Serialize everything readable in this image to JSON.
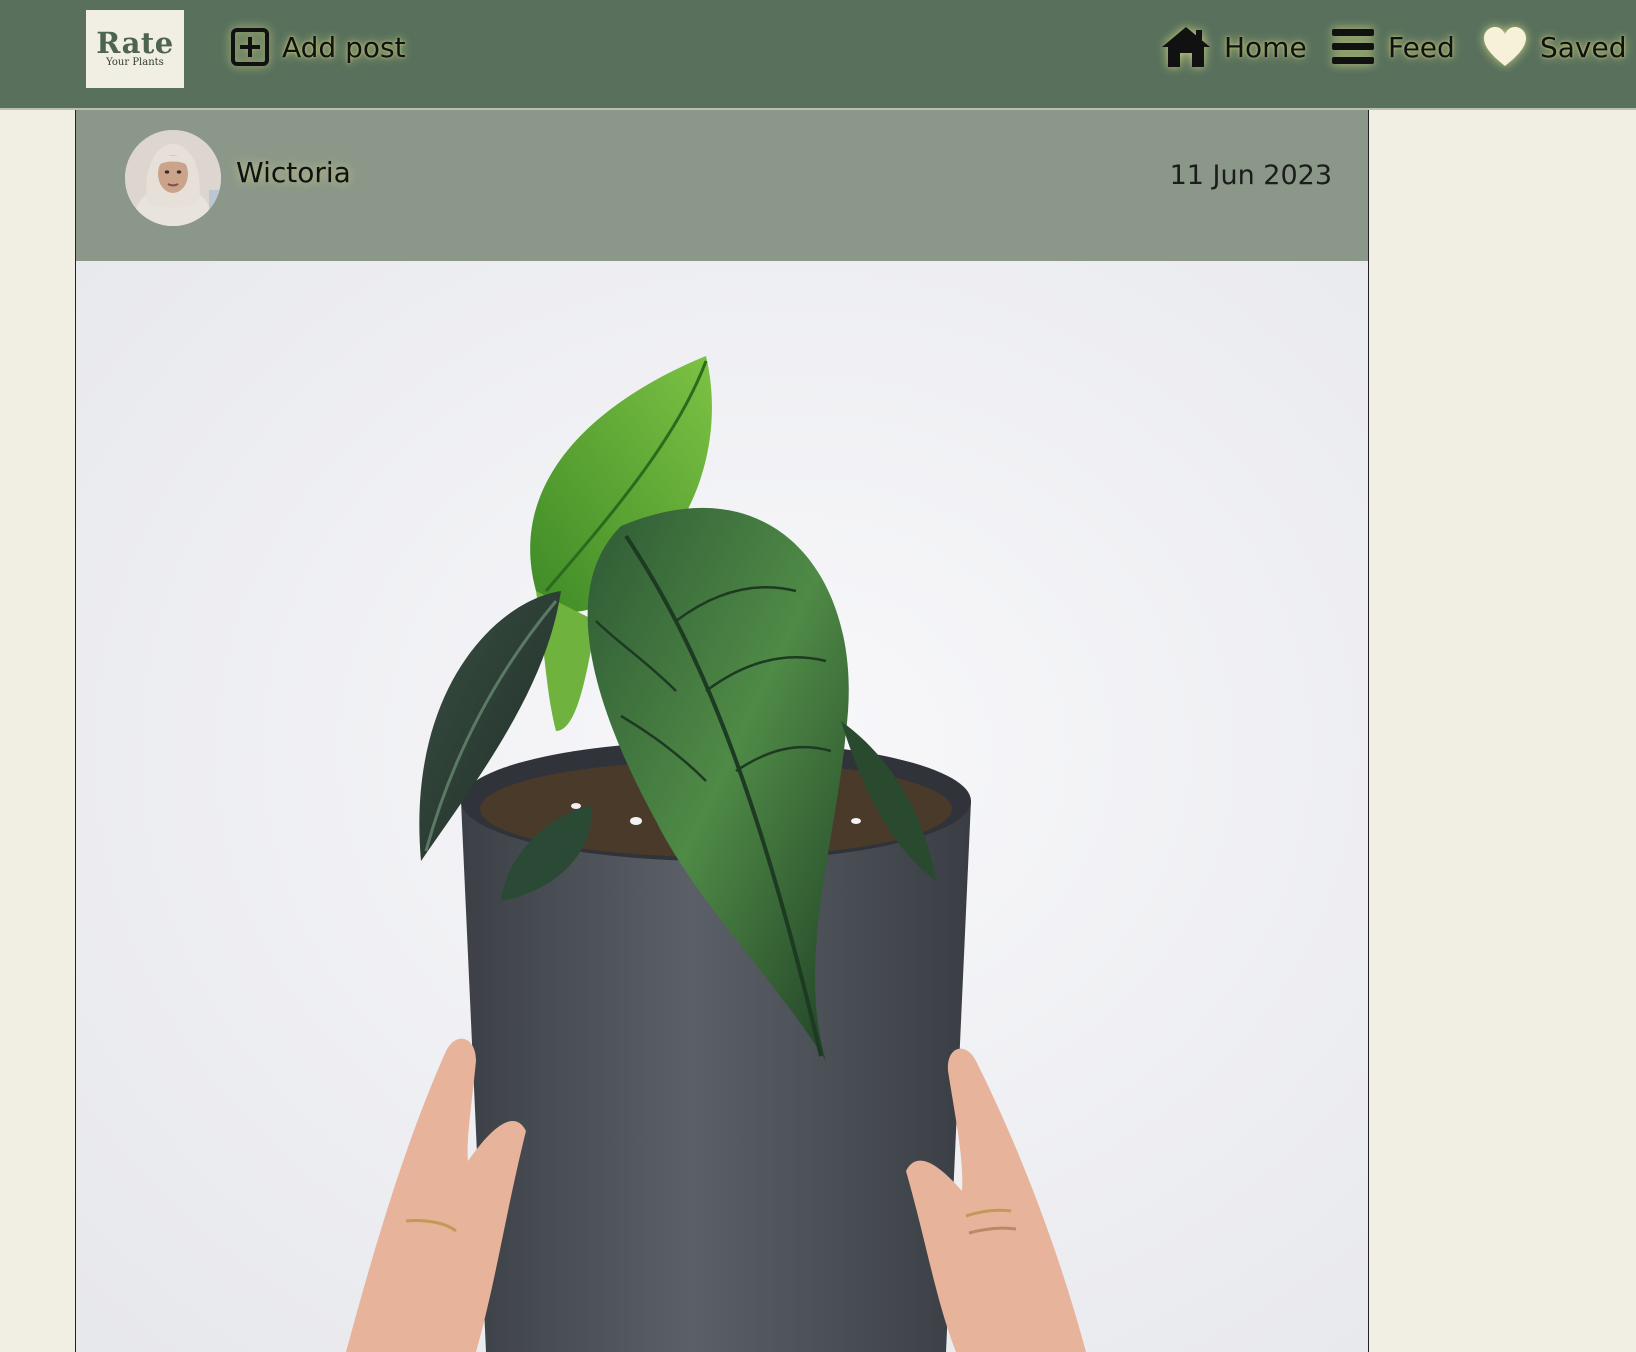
{
  "app": {
    "logo": {
      "title": "Rate",
      "subtitle": "Your Plants"
    }
  },
  "nav": {
    "add_post": {
      "label": "Add post",
      "icon": "plus-square-icon"
    },
    "home": {
      "label": "Home",
      "icon": "home-icon"
    },
    "feed": {
      "label": "Feed",
      "icon": "menu-icon"
    },
    "saved": {
      "label": "Saved",
      "icon": "heart-icon"
    }
  },
  "post": {
    "author": "Wictoria",
    "date": "11 Jun 2023",
    "avatar_icon": "user-avatar",
    "image_icon": "potted-plant-photo"
  },
  "colors": {
    "header_bg": "#58705c",
    "page_bg": "#f1eee3",
    "post_header_bg": "#8b9789",
    "nav_glow": "#f0f08c"
  }
}
